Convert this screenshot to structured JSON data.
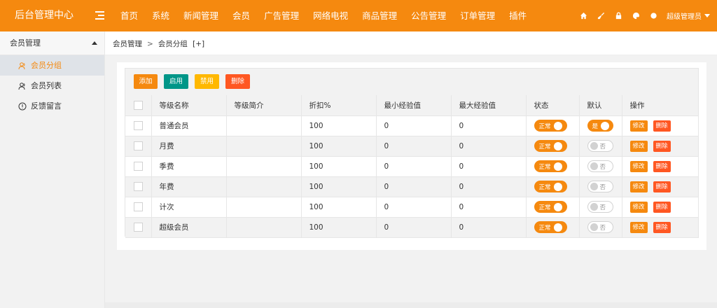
{
  "header": {
    "brand": "后台管理中心",
    "nav": [
      "首页",
      "系统",
      "新闻管理",
      "会员",
      "广告管理",
      "网络电视",
      "商品管理",
      "公告管理",
      "订单管理",
      "插件"
    ],
    "active_nav": "会员",
    "icons": [
      "home-icon",
      "broom-icon",
      "lock-icon",
      "palette-icon",
      "globe-icon"
    ],
    "admin_label": "超级管理员"
  },
  "sidebar": {
    "group": "会员管理",
    "items": [
      {
        "label": "会员分组",
        "icon": "group-icon",
        "active": true
      },
      {
        "label": "会员列表",
        "icon": "users-icon",
        "active": false
      },
      {
        "label": "反馈留言",
        "icon": "info-icon",
        "active": false
      }
    ]
  },
  "breadcrumb": {
    "root": "会员管理",
    "separator": ">",
    "current": "会员分组",
    "extra": "[+]"
  },
  "toolbar": {
    "add": "添加",
    "enable": "启用",
    "disable": "禁用",
    "delete": "删除"
  },
  "table": {
    "headers": [
      "等级名称",
      "等级简介",
      "折扣%",
      "最小经验值",
      "最大经验值",
      "状态",
      "默认",
      "操作"
    ],
    "rows": [
      {
        "name": "普通会员",
        "intro": "",
        "discount": "100",
        "min_exp": "0",
        "max_exp": "0",
        "status": "正常",
        "default": "是",
        "default_on": true
      },
      {
        "name": "月费",
        "intro": "",
        "discount": "100",
        "min_exp": "0",
        "max_exp": "0",
        "status": "正常",
        "default": "否",
        "default_on": false
      },
      {
        "name": "季费",
        "intro": "",
        "discount": "100",
        "min_exp": "0",
        "max_exp": "0",
        "status": "正常",
        "default": "否",
        "default_on": false
      },
      {
        "name": "年费",
        "intro": "",
        "discount": "100",
        "min_exp": "0",
        "max_exp": "0",
        "status": "正常",
        "default": "否",
        "default_on": false
      },
      {
        "name": "计次",
        "intro": "",
        "discount": "100",
        "min_exp": "0",
        "max_exp": "0",
        "status": "正常",
        "default": "否",
        "default_on": false
      },
      {
        "name": "超级会员",
        "intro": "",
        "discount": "100",
        "min_exp": "0",
        "max_exp": "0",
        "status": "正常",
        "default": "否",
        "default_on": false
      }
    ],
    "edit_label": "修改",
    "delete_label": "删除"
  },
  "colors": {
    "accent": "#f5890f",
    "teal": "#009688",
    "yellow": "#ffb800",
    "danger": "#ff5722"
  }
}
